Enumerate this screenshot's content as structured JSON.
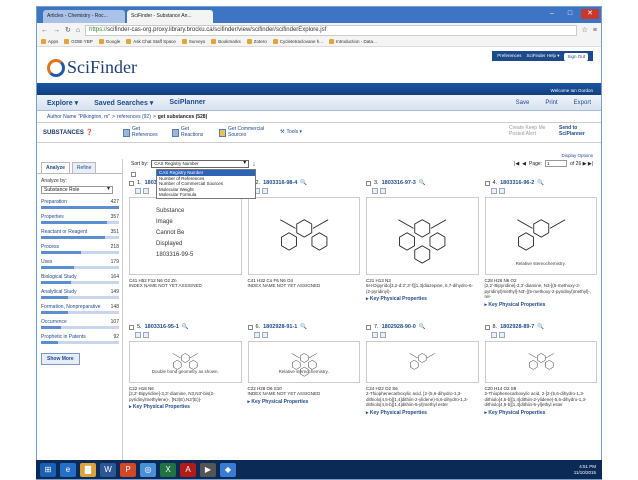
{
  "browser": {
    "tabs": [
      {
        "label": "Articles - Chemistry - Roc..."
      },
      {
        "label": "SciFinder - Substance An..."
      }
    ],
    "url_secure": "https://",
    "url_rest": "scifinder-cas-org.proxy.library.brocku.ca/scifinder/view/scifinder/scifinderExplore.jsf",
    "bookmarks": [
      "Apps",
      "GOBI YBP",
      "Google",
      "Ask Chat Staff Space",
      "Surveys",
      "Bookmarks",
      "Zotero",
      "Cycletetraclovane h...",
      "Introduction - Data..."
    ]
  },
  "header": {
    "logo": "SciFinder",
    "links": [
      "Preferences",
      "SciFinder Help ▾"
    ],
    "signout": "Sign Out",
    "welcome": "Welcome Ian Gordon"
  },
  "nav": {
    "items": [
      "Explore ▾",
      "Saved Searches ▾",
      "SciPlanner"
    ],
    "right": [
      "Save",
      "Print",
      "Export"
    ]
  },
  "breadcrumb": {
    "part1": "Author Name \"Pilkington, m\"",
    "part2": "references (92)",
    "current": "get substances (528)"
  },
  "toolbar": {
    "title": "SUBSTANCES",
    "buttons": [
      "Get References",
      "Get Reactions",
      "Get Commercial Sources",
      "Tools ▾"
    ],
    "right": [
      "Create Keep Me Posted Alert",
      "Send to SciPlanner"
    ]
  },
  "left": {
    "tabs": [
      "Analyze",
      "Refine"
    ],
    "analyze_by_label": "Analyze by:",
    "analyze_by_value": "Substance Role",
    "facets": [
      {
        "label": "Preparation",
        "count": "427",
        "fill": 1.0
      },
      {
        "label": "Properties",
        "count": "357",
        "fill": 0.84
      },
      {
        "label": "Reactant or Reagent",
        "count": "351",
        "fill": 0.82
      },
      {
        "label": "Process",
        "count": "218",
        "fill": 0.51
      },
      {
        "label": "Uses",
        "count": "179",
        "fill": 0.42
      },
      {
        "label": "Biological Study",
        "count": "164",
        "fill": 0.38
      },
      {
        "label": "Analytical Study",
        "count": "149",
        "fill": 0.35
      },
      {
        "label": "Formation, Nonpreparative",
        "count": "148",
        "fill": 0.35
      },
      {
        "label": "Occurrence",
        "count": "107",
        "fill": 0.25
      },
      {
        "label": "Prophetic in Patents",
        "count": "92",
        "fill": 0.22
      }
    ],
    "show_more": "Show More"
  },
  "main": {
    "sort_label": "Sort by:",
    "sort_value": "CAS Registry Number",
    "sort_options": [
      "CAS Registry Number",
      "Number of References",
      "Number of Commercial Sources",
      "Molecular Weight",
      "Molecular Formula"
    ],
    "display_options": "Display Options",
    "page_label": "Page:",
    "page_value": "1",
    "page_total": "of 26 ▶ ▶|",
    "cards": [
      {
        "num": "1.",
        "id": "1803316-99-5",
        "formula": "C41 H52 F12 N6 O2 Zn",
        "name": "INDEX NAME NOT YET ASSIGNED",
        "placeholder": [
          "Substance",
          "Image",
          "Cannot Be",
          "Displayed",
          "1803316-99-5"
        ],
        "caption": "",
        "kpp": ""
      },
      {
        "num": "2.",
        "id": "1803316-98-4",
        "formula": "C41 H32 Co F6 N6 O4",
        "name": "INDEX NAME NOT YET ASSIGNED",
        "placeholder": [],
        "caption": "",
        "kpp": ""
      },
      {
        "num": "3.",
        "id": "1803316-97-3",
        "formula": "C21 H13 N3",
        "name": "5H-Dipyrido[3,2-d:2',3'-f][1,3]diazepine, 6,7-dihydro-6-(2-pyridinyl)-",
        "placeholder": [],
        "caption": "",
        "kpp": "Key Physical Properties"
      },
      {
        "num": "4.",
        "id": "1803316-96-2",
        "formula": "C28 H26 N6 O2",
        "name": "[2,2'-Bipyridine]-3,3'-diamine, N3-[(5-methoxy-2-pyridinyl)methyl]-N3'-[(5-methoxy-2-pyridinyl)methyl]-, rel-",
        "placeholder": [],
        "caption": "Relative stereochemistry.",
        "kpp": "Key Physical Properties"
      },
      {
        "num": "5.",
        "id": "1803316-95-1",
        "formula": "C22 H18 N6",
        "name": "[2,2'-Bipyridine]-3,3'-diamine, N3,N3'-bis(2-pyridinylmethylene)-, [N3(E),N3'(E)]-",
        "placeholder": [],
        "caption": "Double bond geometry as shown.",
        "kpp": "Key Physical Properties"
      },
      {
        "num": "6.",
        "id": "1802928-91-1",
        "formula": "C22 H28 O6 S10",
        "name": "INDEX NAME NOT YET ASSIGNED",
        "placeholder": [],
        "caption": "Relative stereochemistry.",
        "kpp": "Key Physical Properties"
      },
      {
        "num": "7.",
        "id": "1802928-90-0",
        "formula": "C24 H22 O2 S6",
        "name": "2-Thiophenecarboxylic acid, [2-(5,6-dihydro-1,3-dithiolo[4,5-b][1,4]dithiin-2-ylidene)-5,6-dihydro-1,3-dithiolo[4,5-b][1,4]dithiin-5-yl]methyl ester",
        "placeholder": [],
        "caption": "",
        "kpp": "Key Physical Properties"
      },
      {
        "num": "8.",
        "id": "1802928-89-7",
        "formula": "C20 H14 O2 S9",
        "name": "2-Thiophenecarboxylic acid, 2-[2-(5,6-dihydro-1,3-dithiolo[4,5-b][1,4]dithiin-2-ylidene)-5,6-dihydro-1,3-dithiolo[4,5-b][1,4]dithiin-5-yl]ethyl ester",
        "placeholder": [],
        "caption": "",
        "kpp": "Key Physical Properties"
      }
    ]
  },
  "taskbar": {
    "time": "4:51 PM",
    "date": "11/10/2015"
  }
}
